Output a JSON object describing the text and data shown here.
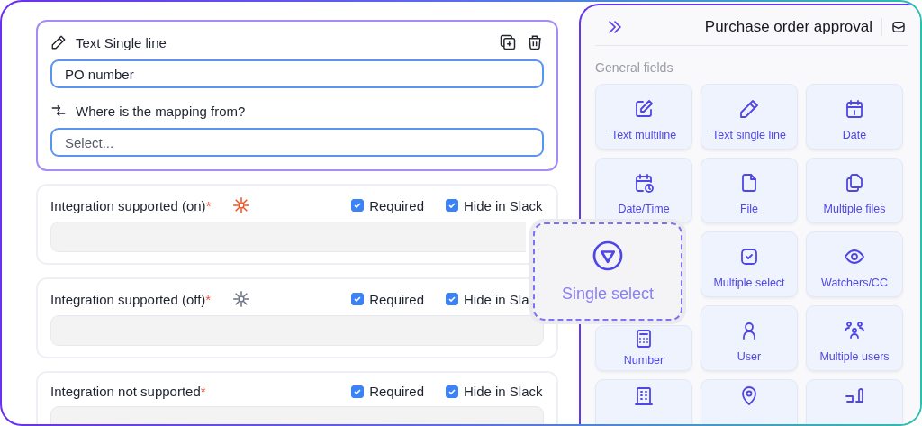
{
  "editor_card": {
    "type_label": "Text Single line",
    "name_value": "PO number",
    "mapping_label": "Where is the mapping from?",
    "mapping_placeholder": "Select..."
  },
  "fields": [
    {
      "label": "Integration supported (on)",
      "asterisk": "*",
      "kind": "integration-on",
      "required": {
        "label": "Required",
        "checked": true
      },
      "hide": {
        "label": "Hide in Slack",
        "checked": true
      }
    },
    {
      "label": "Integration supported (off)",
      "asterisk": "*",
      "kind": "integration-off",
      "required": {
        "label": "Required",
        "checked": true
      },
      "hide": {
        "label": "Hide in Sla",
        "checked": true
      }
    },
    {
      "label": "Integration not supported",
      "asterisk": "*",
      "kind": "plain",
      "required": {
        "label": "Required",
        "checked": true
      },
      "hide": {
        "label": "Hide in Slack",
        "checked": true
      }
    }
  ],
  "panel": {
    "title": "Purchase order approval",
    "section": "General fields",
    "tiles": [
      {
        "label": "Text multiline"
      },
      {
        "label": "Text single line"
      },
      {
        "label": "Date"
      },
      {
        "label": "Date/Time"
      },
      {
        "label": "File"
      },
      {
        "label": "Multiple files"
      },
      {
        "label": "Multiple select"
      },
      {
        "label": "Watchers/CC"
      },
      {
        "label": "Number"
      },
      {
        "label": "User"
      },
      {
        "label": "Multiple users"
      }
    ]
  },
  "dragged_tile": {
    "label": "Single select"
  }
}
